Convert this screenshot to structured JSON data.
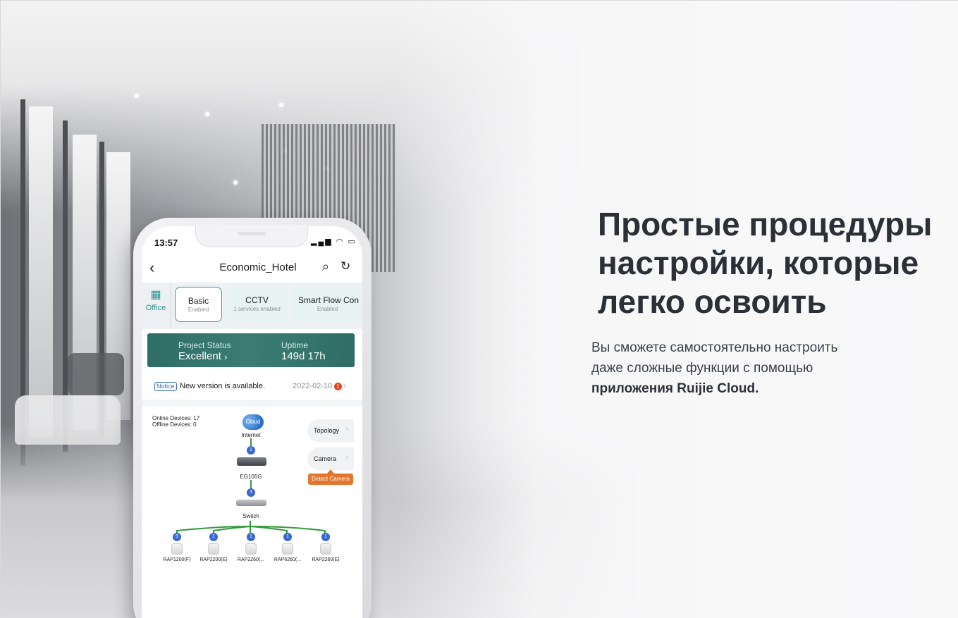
{
  "hero": {
    "headline_line1": "Простые процедуры",
    "headline_line2": "настройки, которые",
    "headline_line3": "легко освоить",
    "description_line1": "Вы сможете самостоятельно настроить",
    "description_line2": "даже сложные функции с помощью",
    "description_bold": "приложения Ruijie Cloud."
  },
  "phone": {
    "status_bar": {
      "time": "13:57",
      "icons": "signal wifi battery"
    },
    "nav": {
      "title": "Economic_Hotel",
      "back_icon": "chevron-left-icon",
      "search_icon": "search-icon",
      "refresh_icon": "refresh-icon"
    },
    "tabs": {
      "office": {
        "label": "Office",
        "icon": "building-icon"
      },
      "items": [
        {
          "title": "Basic",
          "sub": "Enabled"
        },
        {
          "title": "CCTV",
          "sub": "1 services enabled"
        },
        {
          "title": "Smart Flow Con",
          "sub": "Enabled"
        }
      ]
    },
    "project": {
      "status_label": "Project Status",
      "status_value": "Excellent",
      "uptime_label": "Uptime",
      "uptime_value": "149d 17h"
    },
    "notice": {
      "tag": "Notice",
      "text": "New version is available.",
      "date": "2022-02-10",
      "count": "1"
    },
    "topology": {
      "online": "Online Devices: 17",
      "offline": "Offline Devices: 0",
      "cloud_label": "Cloud",
      "internet_label": "Internet",
      "router_count": "1",
      "router_label": "EG105G",
      "switch_count": "3",
      "switch_label": "Switch",
      "topology_button": "Topology",
      "camera_button": "Camera",
      "detect_button": "Detect Camera",
      "aps": [
        {
          "count": "9",
          "label": "RAP1200(F)"
        },
        {
          "count": "1",
          "label": "RAP2200(E)"
        },
        {
          "count": "1",
          "label": "RAP2260(..."
        },
        {
          "count": "1",
          "label": "RAP6260(..."
        },
        {
          "count": "1",
          "label": "RAP2260(E)"
        }
      ]
    }
  },
  "colors": {
    "accent_teal": "#3e9c96",
    "status_band": "#2f6d66",
    "detect_orange": "#e2762e",
    "badge_blue": "#3767d1",
    "link_green": "#2f9a3a"
  }
}
